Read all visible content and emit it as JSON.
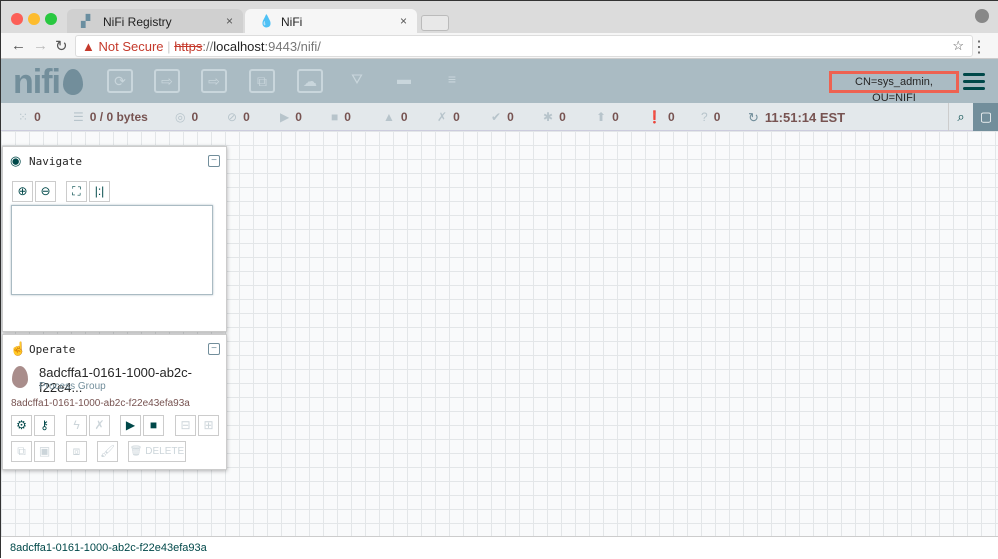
{
  "browser": {
    "tabs": [
      {
        "label": "NiFi Registry",
        "close": "×"
      },
      {
        "label": "NiFi",
        "close": "×"
      }
    ],
    "security": "Not Secure",
    "url_scheme": "https",
    "url_sep": "://",
    "url_host": "localhost",
    "url_rest": ":9443/nifi/"
  },
  "header": {
    "logo": "nifi",
    "user": "CN=sys_admin, OU=NIFI"
  },
  "status": {
    "components": "0",
    "queued": "0 / 0 bytes",
    "transmitting": "0",
    "not_transmitting": "0",
    "running": "0",
    "stopped": "0",
    "invalid": "0",
    "disabled": "0",
    "up_to_date": "0",
    "locally_modified": "0",
    "stale": "0",
    "sync_failure": "0",
    "unknown": "0",
    "refreshed": "11:51:14 EST"
  },
  "navigate": {
    "title": "Navigate"
  },
  "operate": {
    "title": "Operate",
    "name": "8adcffa1-0161-1000-ab2c-f22e4...",
    "type": "Process Group",
    "id": "8adcffa1-0161-1000-ab2c-f22e43efa93a",
    "delete_label": "DELETE"
  },
  "footer": {
    "breadcrumb": "8adcffa1-0161-1000-ab2c-f22e43efa93a"
  }
}
